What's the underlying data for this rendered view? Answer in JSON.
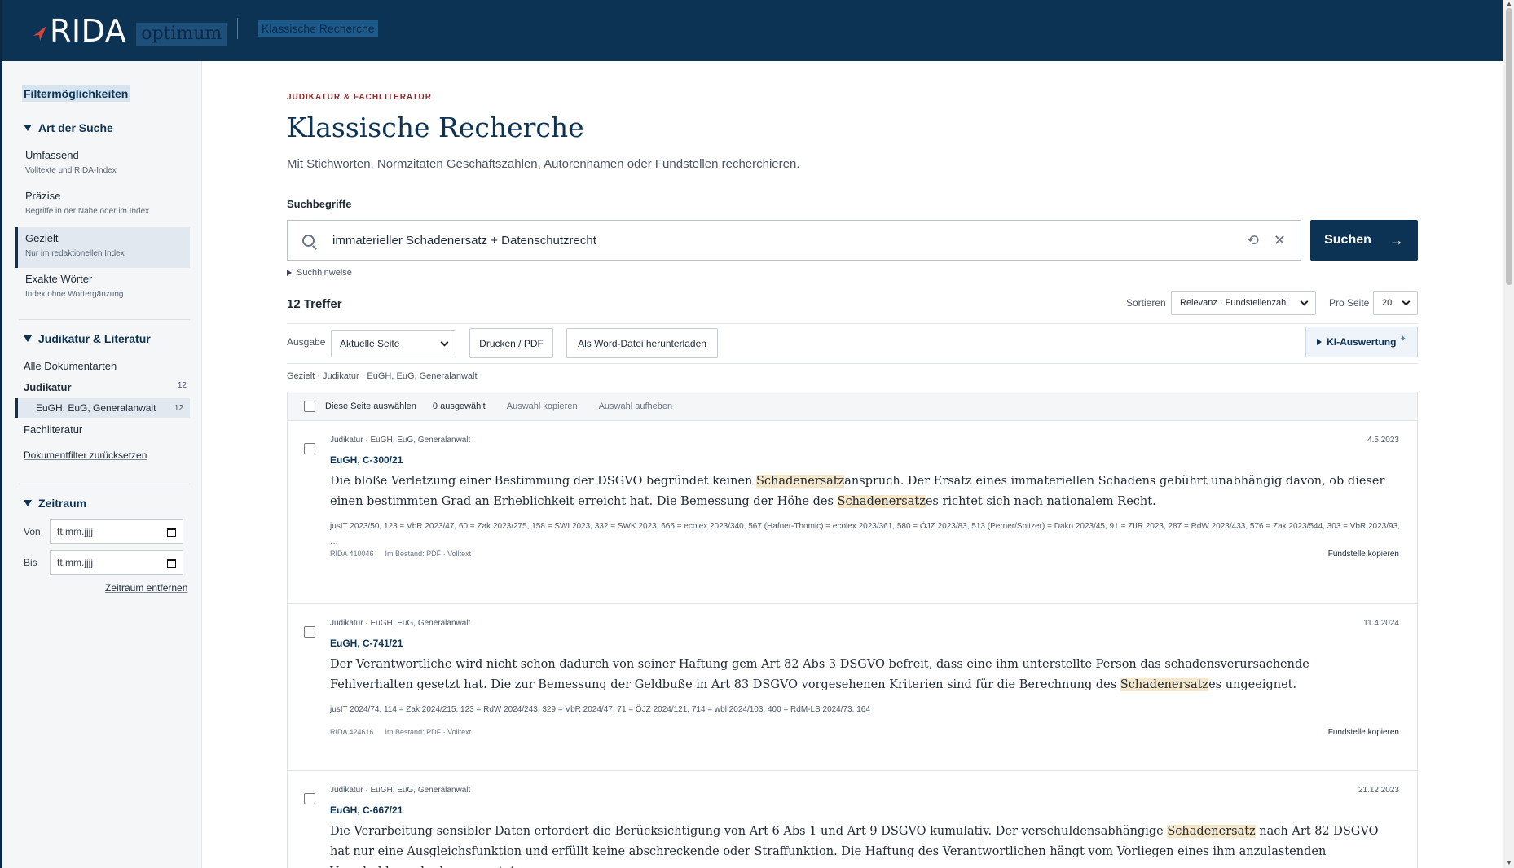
{
  "header": {
    "logo_text": "RIDA",
    "logo_sub": "optimum",
    "breadcrumb": "Klassische Recherche"
  },
  "sidebar": {
    "title": "Filtermöglichkeiten",
    "search_type": {
      "heading": "Art der Suche",
      "options": [
        {
          "label": "Umfassend",
          "desc": "Volltexte und RIDA-Index"
        },
        {
          "label": "Präzise",
          "desc": "Begriffe in der Nähe oder im Index"
        },
        {
          "label": "Gezielt",
          "desc": "Nur im redaktionellen Index"
        },
        {
          "label": "Exakte Wörter",
          "desc": "Index ohne Wortergänzung"
        }
      ]
    },
    "doc_types": {
      "heading": "Judikatur & Literatur",
      "all_label": "Alle Dokumentarten",
      "judikatur_label": "Judikatur",
      "judikatur_count": "12",
      "sub_label": "EuGH, EuG, Generalanwalt",
      "sub_count": "12",
      "fachliteratur_label": "Fachliteratur",
      "reset_link": "Dokumentfilter zurücksetzen"
    },
    "period": {
      "heading": "Zeitraum",
      "from_label": "Von",
      "from_placeholder": "tt.mm.jjjj",
      "to_label": "Bis",
      "to_placeholder": "tt.mm.jjjj",
      "remove_link": "Zeitraum entfernen"
    }
  },
  "main": {
    "eyebrow": "JUDIKATUR & FACHLITERATUR",
    "title": "Klassische Recherche",
    "subtitle": "Mit Stichworten, Normzitaten Geschäftszahlen, Autorennamen oder Fundstellen recherchieren.",
    "search_label": "Suchbegriffe",
    "search_value": "immaterieller Schadenersatz + Datenschutzrecht",
    "search_button": "Suchen",
    "hint": "Suchhinweise",
    "hits": "12 Treffer",
    "sort_label": "Sortieren",
    "sort_value": "Relevanz · Fundstellenzahl",
    "per_page_label": "Pro Seite",
    "per_page_value": "20",
    "output_label": "Ausgabe",
    "output_value": "Aktuelle Seite",
    "print_button": "Drucken / PDF",
    "word_button": "Als Word-Datei herunterladen",
    "ki_button": "KI-Auswertung",
    "filter_crumbs": "Gezielt · Judikatur · EuGH, EuG, Generalanwalt",
    "results_head": {
      "select_page": "Diese Seite auswählen",
      "selected_count": "0 ausgewählt",
      "copy_selection": "Auswahl kopieren",
      "clear_selection": "Auswahl aufheben"
    },
    "results": [
      {
        "meta": "Judikatur · EuGH, EuG, Generalanwalt",
        "date": "4.5.2023",
        "case": "EuGH, C-300/21",
        "text_parts": [
          "Die bloße Verletzung einer Bestimmung der DSGVO begründet keinen ",
          "Schadenersatz",
          "anspruch. Der Ersatz eines immateriellen Schadens gebührt unabhängig davon, ob dieser einen bestimmten Grad an Erheblichkeit erreicht hat. Die Bemessung der Höhe des ",
          "Schadenersatz",
          "es richtet sich nach nationalem Recht."
        ],
        "refs": "jusIT 2023/50, 123 = VbR 2023/47, 60 = Zak 2023/275, 158 = SWI 2023, 332 = SWK 2023, 665 = ecolex 2023/340, 567 (Hafner-Thomic) = ecolex 2023/361, 580 = ÖJZ 2023/83, 513 (Perner/Spitzer) = Dako 2023/45, 91 = ZIIR 2023, 287 = RdW 2023/433, 576 = Zak 2023/544, 303 = VbR 2023/93, …",
        "rida_id": "RIDA 410046",
        "stock": "Im Bestand: PDF · Volltext",
        "copy": "Fundstelle kopieren"
      },
      {
        "meta": "Judikatur · EuGH, EuG, Generalanwalt",
        "date": "11.4.2024",
        "case": "EuGH, C-741/21",
        "text_parts": [
          "Der Verantwortliche wird nicht schon dadurch von seiner Haftung gem Art 82 Abs 3 DSGVO befreit, dass eine ihm unterstellte Person das schadensverursachende Fehlverhalten gesetzt hat. Die zur Bemessung der Geldbuße in Art 83 DSGVO vorgesehenen Kriterien sind für die Berechnung des ",
          "Schadenersatz",
          "es ungeeignet.",
          "",
          ""
        ],
        "refs": "jusIT 2024/74, 114 = Zak 2024/215, 123 = RdW 2024/243, 329 = VbR 2024/47, 71 = ÖJZ 2024/121, 714 = wbl 2024/103, 400 = RdM-LS 2024/73, 164",
        "rida_id": "RIDA 424616",
        "stock": "Im Bestand: PDF · Volltext",
        "copy": "Fundstelle kopieren"
      },
      {
        "meta": "Judikatur · EuGH, EuG, Generalanwalt",
        "date": "21.12.2023",
        "case": "EuGH, C-667/21",
        "text_parts": [
          "Die Verarbeitung sensibler Daten erfordert die Berücksichtigung von Art 6 Abs 1 und Art 9 DSGVO kumulativ. Der verschuldensabhängige ",
          "Schadenersatz",
          " nach Art 82 DSGVO hat nur eine Ausgleichsfunktion und erfüllt keine abschreckende oder Straffunktion. Die Haftung des Verantwortlichen hängt vom Vorliegen eines ihm anzulastenden Verschuldens ab, das vermutet",
          "",
          ""
        ]
      }
    ]
  },
  "colors": {
    "brand_navy": "#0d3354",
    "highlight": "#f6e7c8",
    "eyebrow_red": "#8a2b2b"
  }
}
